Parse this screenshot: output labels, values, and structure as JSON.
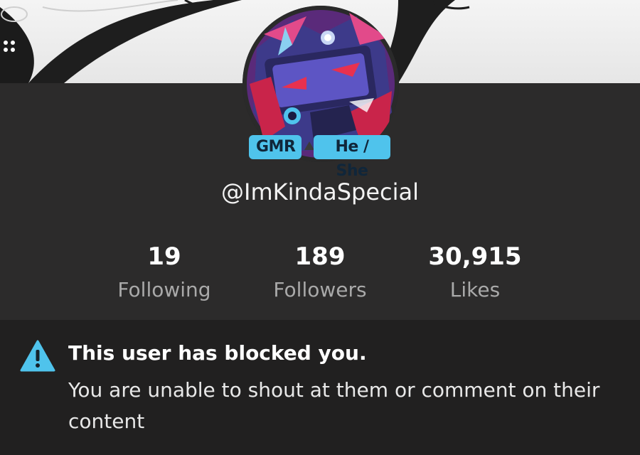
{
  "profile": {
    "tags": {
      "badge": "GMR",
      "pronouns": "He / She"
    },
    "username": "@ImKindaSpecial"
  },
  "stats": [
    {
      "value": "19",
      "label": "Following"
    },
    {
      "value": "189",
      "label": "Followers"
    },
    {
      "value": "30,915",
      "label": "Likes"
    }
  ],
  "notice": {
    "title": "This user has blocked you.",
    "message": "You are unable to shout at them or comment on their content",
    "icon": "warning-icon"
  },
  "colors": {
    "tag_background": "#4fc3ec",
    "panel_background": "#2c2b2b",
    "notice_background": "#212020",
    "warning_accent": "#4fc3ec"
  }
}
